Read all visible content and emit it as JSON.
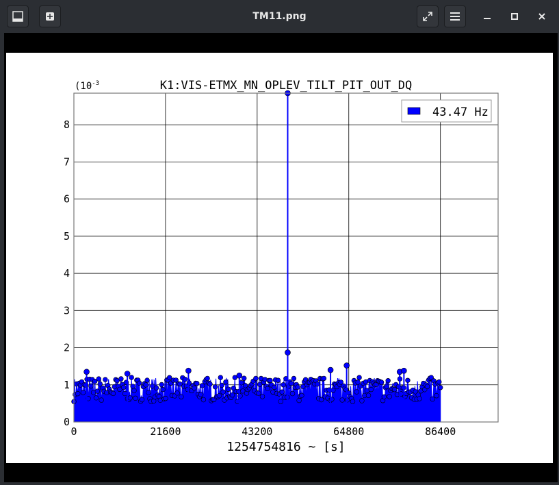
{
  "window": {
    "title": "TM11.png",
    "icons": {
      "left1": "image-view-icon",
      "left2": "new-window-icon",
      "fullscreen": "fullscreen-icon",
      "menu": "hamburger-menu-icon",
      "minimize": "minimize-icon",
      "maximize": "maximize-icon",
      "close": "close-icon"
    }
  },
  "chart_data": {
    "type": "scatter",
    "title": "K1:VIS-ETMX_MN_OPLEV_TILT_PIT_OUT_DQ",
    "exponent_label": "(10",
    "exponent_sup": "-3",
    "xlabel": "1254754816 ~ [s]",
    "ylabel": "",
    "xlim": [
      0,
      100000
    ],
    "ylim": [
      0,
      8.85
    ],
    "x_ticks": [
      0,
      21600,
      43200,
      64800,
      86400
    ],
    "y_ticks": [
      0,
      1,
      2,
      3,
      4,
      5,
      6,
      7,
      8
    ],
    "grid": true,
    "legend": {
      "placement": "top-right",
      "entries": [
        "43.47 Hz"
      ]
    },
    "series": [
      {
        "name": "43.47 Hz",
        "color": "#0000ff",
        "highlight_points": [
          {
            "x": 50400,
            "y": 8.85
          },
          {
            "x": 50400,
            "y": 1.87
          },
          {
            "x": 3000,
            "y": 1.35
          },
          {
            "x": 27000,
            "y": 1.38
          },
          {
            "x": 60500,
            "y": 1.4
          },
          {
            "x": 64300,
            "y": 1.52
          },
          {
            "x": 76800,
            "y": 1.35
          },
          {
            "x": 77800,
            "y": 1.38
          },
          {
            "x": 39000,
            "y": 1.25
          },
          {
            "x": 12600,
            "y": 1.3
          }
        ],
        "baseline_range": [
          0.55,
          1.2
        ],
        "x_range": [
          0,
          86400
        ]
      }
    ]
  }
}
